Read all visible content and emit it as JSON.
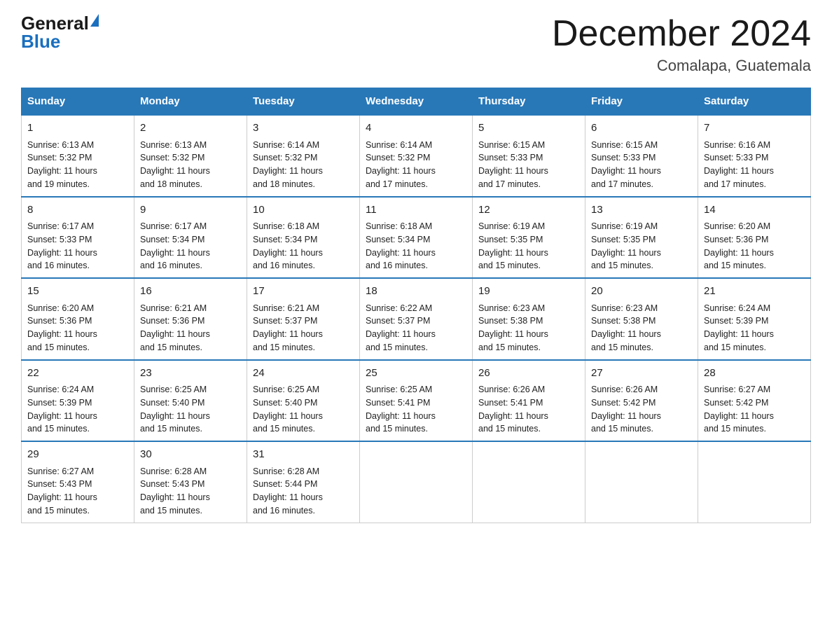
{
  "header": {
    "logo_general": "General",
    "logo_blue": "Blue",
    "month_title": "December 2024",
    "location": "Comalapa, Guatemala"
  },
  "days_of_week": [
    "Sunday",
    "Monday",
    "Tuesday",
    "Wednesday",
    "Thursday",
    "Friday",
    "Saturday"
  ],
  "weeks": [
    [
      {
        "day": "1",
        "sunrise": "6:13 AM",
        "sunset": "5:32 PM",
        "daylight": "11 hours and 19 minutes."
      },
      {
        "day": "2",
        "sunrise": "6:13 AM",
        "sunset": "5:32 PM",
        "daylight": "11 hours and 18 minutes."
      },
      {
        "day": "3",
        "sunrise": "6:14 AM",
        "sunset": "5:32 PM",
        "daylight": "11 hours and 18 minutes."
      },
      {
        "day": "4",
        "sunrise": "6:14 AM",
        "sunset": "5:32 PM",
        "daylight": "11 hours and 17 minutes."
      },
      {
        "day": "5",
        "sunrise": "6:15 AM",
        "sunset": "5:33 PM",
        "daylight": "11 hours and 17 minutes."
      },
      {
        "day": "6",
        "sunrise": "6:15 AM",
        "sunset": "5:33 PM",
        "daylight": "11 hours and 17 minutes."
      },
      {
        "day": "7",
        "sunrise": "6:16 AM",
        "sunset": "5:33 PM",
        "daylight": "11 hours and 17 minutes."
      }
    ],
    [
      {
        "day": "8",
        "sunrise": "6:17 AM",
        "sunset": "5:33 PM",
        "daylight": "11 hours and 16 minutes."
      },
      {
        "day": "9",
        "sunrise": "6:17 AM",
        "sunset": "5:34 PM",
        "daylight": "11 hours and 16 minutes."
      },
      {
        "day": "10",
        "sunrise": "6:18 AM",
        "sunset": "5:34 PM",
        "daylight": "11 hours and 16 minutes."
      },
      {
        "day": "11",
        "sunrise": "6:18 AM",
        "sunset": "5:34 PM",
        "daylight": "11 hours and 16 minutes."
      },
      {
        "day": "12",
        "sunrise": "6:19 AM",
        "sunset": "5:35 PM",
        "daylight": "11 hours and 15 minutes."
      },
      {
        "day": "13",
        "sunrise": "6:19 AM",
        "sunset": "5:35 PM",
        "daylight": "11 hours and 15 minutes."
      },
      {
        "day": "14",
        "sunrise": "6:20 AM",
        "sunset": "5:36 PM",
        "daylight": "11 hours and 15 minutes."
      }
    ],
    [
      {
        "day": "15",
        "sunrise": "6:20 AM",
        "sunset": "5:36 PM",
        "daylight": "11 hours and 15 minutes."
      },
      {
        "day": "16",
        "sunrise": "6:21 AM",
        "sunset": "5:36 PM",
        "daylight": "11 hours and 15 minutes."
      },
      {
        "day": "17",
        "sunrise": "6:21 AM",
        "sunset": "5:37 PM",
        "daylight": "11 hours and 15 minutes."
      },
      {
        "day": "18",
        "sunrise": "6:22 AM",
        "sunset": "5:37 PM",
        "daylight": "11 hours and 15 minutes."
      },
      {
        "day": "19",
        "sunrise": "6:23 AM",
        "sunset": "5:38 PM",
        "daylight": "11 hours and 15 minutes."
      },
      {
        "day": "20",
        "sunrise": "6:23 AM",
        "sunset": "5:38 PM",
        "daylight": "11 hours and 15 minutes."
      },
      {
        "day": "21",
        "sunrise": "6:24 AM",
        "sunset": "5:39 PM",
        "daylight": "11 hours and 15 minutes."
      }
    ],
    [
      {
        "day": "22",
        "sunrise": "6:24 AM",
        "sunset": "5:39 PM",
        "daylight": "11 hours and 15 minutes."
      },
      {
        "day": "23",
        "sunrise": "6:25 AM",
        "sunset": "5:40 PM",
        "daylight": "11 hours and 15 minutes."
      },
      {
        "day": "24",
        "sunrise": "6:25 AM",
        "sunset": "5:40 PM",
        "daylight": "11 hours and 15 minutes."
      },
      {
        "day": "25",
        "sunrise": "6:25 AM",
        "sunset": "5:41 PM",
        "daylight": "11 hours and 15 minutes."
      },
      {
        "day": "26",
        "sunrise": "6:26 AM",
        "sunset": "5:41 PM",
        "daylight": "11 hours and 15 minutes."
      },
      {
        "day": "27",
        "sunrise": "6:26 AM",
        "sunset": "5:42 PM",
        "daylight": "11 hours and 15 minutes."
      },
      {
        "day": "28",
        "sunrise": "6:27 AM",
        "sunset": "5:42 PM",
        "daylight": "11 hours and 15 minutes."
      }
    ],
    [
      {
        "day": "29",
        "sunrise": "6:27 AM",
        "sunset": "5:43 PM",
        "daylight": "11 hours and 15 minutes."
      },
      {
        "day": "30",
        "sunrise": "6:28 AM",
        "sunset": "5:43 PM",
        "daylight": "11 hours and 15 minutes."
      },
      {
        "day": "31",
        "sunrise": "6:28 AM",
        "sunset": "5:44 PM",
        "daylight": "11 hours and 16 minutes."
      },
      null,
      null,
      null,
      null
    ]
  ],
  "labels": {
    "sunrise": "Sunrise:",
    "sunset": "Sunset:",
    "daylight": "Daylight:"
  }
}
